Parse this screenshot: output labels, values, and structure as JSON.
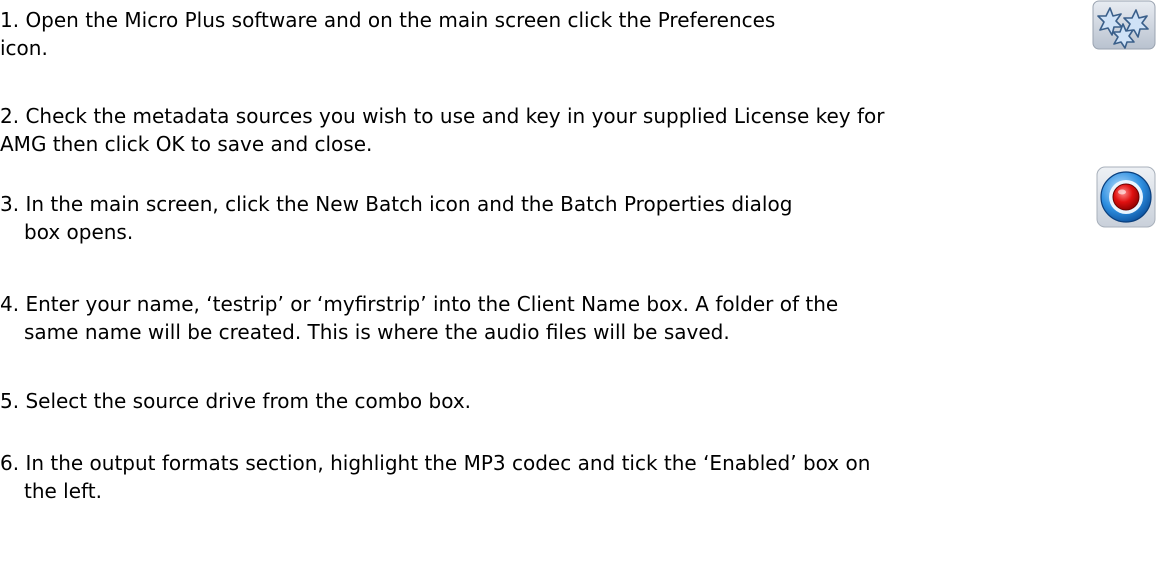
{
  "steps": [
    {
      "line1": "1.  Open the Micro Plus software and on the main screen click the Preferences",
      "line2": "icon."
    },
    {
      "line1": "2.  Check the metadata sources you wish to use and key in your supplied License key for",
      "line2": "AMG then click OK to save and close."
    },
    {
      "line1": "3.  In the main screen, click the New Batch icon and the Batch Properties dialog",
      "line2": "box opens."
    },
    {
      "line1": "4.  Enter your name, ‘testrip’ or ‘myfirstrip’ into the Client Name box.  A folder of the",
      "line2": "same name will be created.  This is where the audio files will be saved."
    },
    {
      "line1": "5.  Select the source drive from the combo box."
    },
    {
      "line1": "6.  In the output formats section, highlight the MP3 codec and tick the ‘Enabled’ box on",
      "line2": "the left."
    }
  ],
  "icons": {
    "preferences": "preferences-icon",
    "new_batch": "new-batch-icon"
  },
  "colors": {
    "text": "#000000",
    "background": "#ffffff",
    "batch_ring": "#2e8fe0",
    "batch_center": "#e01010"
  }
}
